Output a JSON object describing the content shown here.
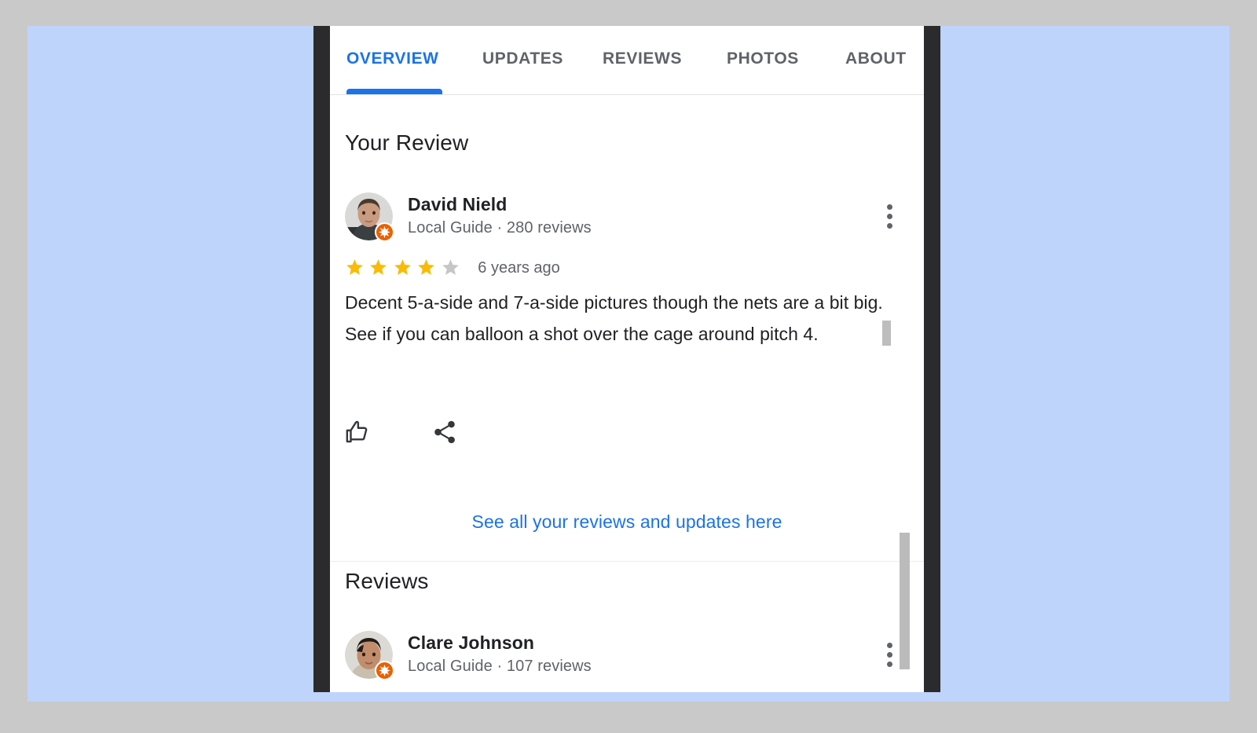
{
  "tabs": [
    {
      "label": "OVERVIEW",
      "active": true
    },
    {
      "label": "UPDATES",
      "active": false
    },
    {
      "label": "REVIEWS",
      "active": false
    },
    {
      "label": "PHOTOS",
      "active": false
    },
    {
      "label": "ABOUT",
      "active": false
    }
  ],
  "colors": {
    "accent": "#1a73e8",
    "star_filled": "#fabb05",
    "star_empty": "#c4c7c5",
    "badge": "#ea6100",
    "text_primary": "#202124",
    "text_secondary": "#5f6368",
    "backdrop": "#bed4fb",
    "frame": "#2b2b2d",
    "page_border": "#c9c9c9"
  },
  "your_review_section": {
    "heading": "Your Review",
    "review": {
      "author": "David Nield",
      "meta": "Local Guide · 280 reviews",
      "badge_icon": "local-guide-star-badge",
      "rating": 4,
      "rating_max": 5,
      "age": "6 years ago",
      "body": "Decent 5-a-side and 7-a-side pictures though the nets are a bit big. See if you can balloon a shot over the cage around pitch 4.",
      "actions": [
        {
          "name": "like",
          "icon": "thumbs-up-icon"
        },
        {
          "name": "share",
          "icon": "share-icon"
        }
      ],
      "menu_icon": "more-options-icon"
    },
    "see_all_link": "See all your reviews and updates here"
  },
  "reviews_section": {
    "heading": "Reviews",
    "reviews": [
      {
        "author": "Clare Johnson",
        "meta": "Local Guide · 107 reviews",
        "badge_icon": "local-guide-star-badge",
        "menu_icon": "more-options-icon"
      }
    ]
  },
  "scrollbars": {
    "inner_thumb": "review-text-scroll-thumb",
    "outer_thumb": "page-scroll-thumb"
  }
}
